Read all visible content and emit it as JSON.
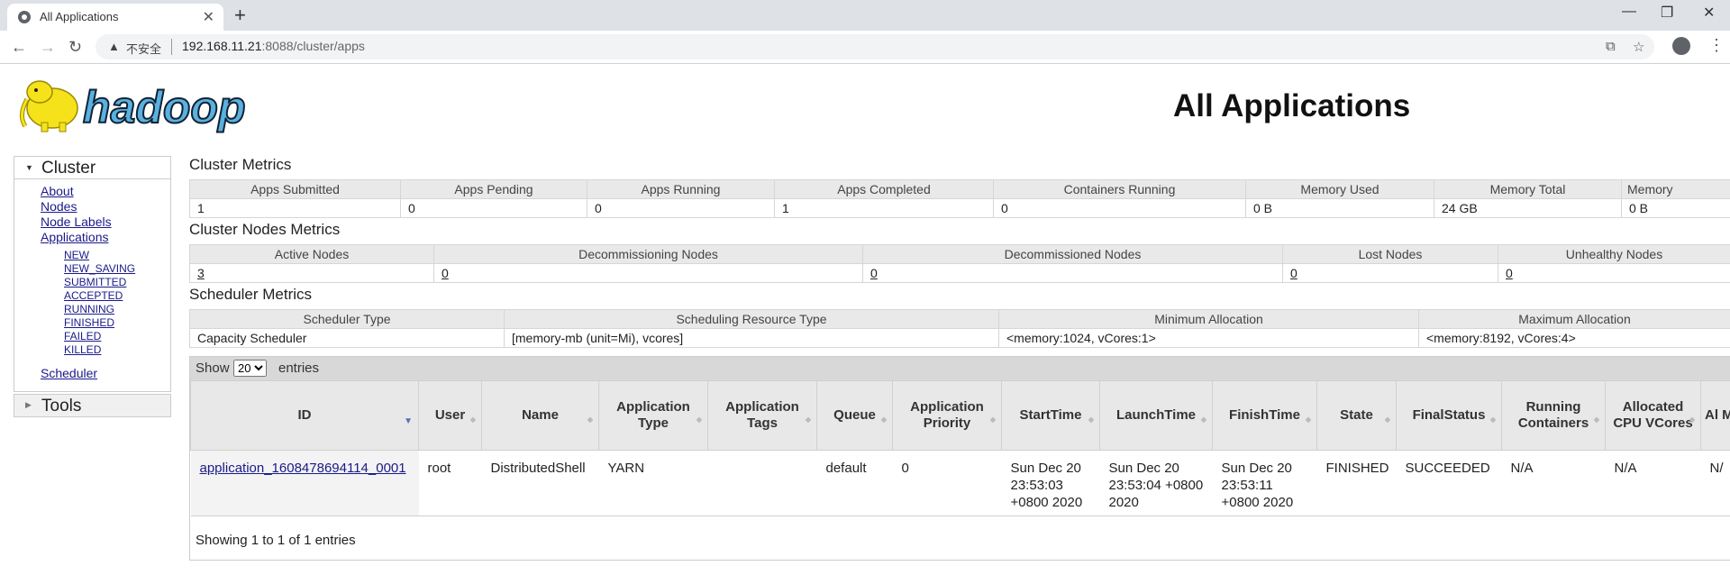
{
  "browser": {
    "tab_title": "All Applications",
    "new_tab": "+",
    "insecure_label": "不安全",
    "url_host": "192.168.11.21",
    "url_rest": ":8088/cluster/apps"
  },
  "page": {
    "title": "All Applications",
    "logo_text": "hadoop"
  },
  "sidebar": {
    "cluster_label": "Cluster",
    "links": [
      "About",
      "Nodes",
      "Node Labels",
      "Applications"
    ],
    "app_states": [
      "NEW",
      "NEW_SAVING",
      "SUBMITTED",
      "ACCEPTED",
      "RUNNING",
      "FINISHED",
      "FAILED",
      "KILLED"
    ],
    "scheduler": "Scheduler",
    "tools_label": "Tools"
  },
  "cluster_metrics": {
    "title": "Cluster Metrics",
    "headers": [
      "Apps Submitted",
      "Apps Pending",
      "Apps Running",
      "Apps Completed",
      "Containers Running",
      "Memory Used",
      "Memory Total",
      "Memory"
    ],
    "values": [
      "1",
      "0",
      "0",
      "1",
      "0",
      "0 B",
      "24 GB",
      "0 B"
    ]
  },
  "cluster_nodes_metrics": {
    "title": "Cluster Nodes Metrics",
    "headers": [
      "Active Nodes",
      "Decommissioning Nodes",
      "Decommissioned Nodes",
      "Lost Nodes",
      "Unhealthy Nodes"
    ],
    "values": [
      "3",
      "0",
      "0",
      "0",
      "0"
    ]
  },
  "scheduler_metrics": {
    "title": "Scheduler Metrics",
    "headers": [
      "Scheduler Type",
      "Scheduling Resource Type",
      "Minimum Allocation",
      "Maximum Allocation"
    ],
    "values": [
      "Capacity Scheduler",
      "[memory-mb (unit=Mi), vcores]",
      "<memory:1024, vCores:1>",
      "<memory:8192, vCores:4>"
    ]
  },
  "apps_table": {
    "show_label": "Show",
    "page_size": "20",
    "entries_label": "entries",
    "headers": [
      "ID",
      "User",
      "Name",
      "Application Type",
      "Application Tags",
      "Queue",
      "Application Priority",
      "StartTime",
      "LaunchTime",
      "FinishTime",
      "State",
      "FinalStatus",
      "Running Containers",
      "Allocated CPU VCores",
      "Al M"
    ],
    "rows": [
      [
        "application_1608478694114_0001",
        "root",
        "DistributedShell",
        "YARN",
        "",
        "default",
        "0",
        "Sun Dec 20 23:53:03 +0800 2020",
        "Sun Dec 20 23:53:04 +0800 2020",
        "Sun Dec 20 23:53:11 +0800 2020",
        "FINISHED",
        "SUCCEEDED",
        "N/A",
        "N/A",
        "N/"
      ]
    ],
    "footer": "Showing 1 to 1 of 1 entries"
  },
  "colors": {
    "link": "#1a1a8a",
    "header_bg": "#e9e9e9",
    "logo_yellow": "#f5e21a",
    "logo_blue": "#5ab1e0"
  }
}
